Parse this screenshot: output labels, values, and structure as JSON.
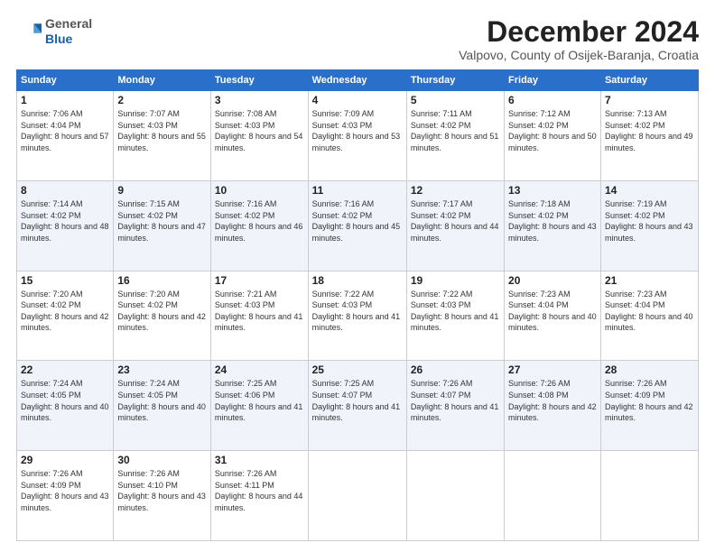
{
  "logo": {
    "general": "General",
    "blue": "Blue"
  },
  "title": "December 2024",
  "location": "Valpovo, County of Osijek-Baranja, Croatia",
  "headers": [
    "Sunday",
    "Monday",
    "Tuesday",
    "Wednesday",
    "Thursday",
    "Friday",
    "Saturday"
  ],
  "weeks": [
    [
      {
        "day": "1",
        "sunrise": "Sunrise: 7:06 AM",
        "sunset": "Sunset: 4:04 PM",
        "daylight": "Daylight: 8 hours and 57 minutes."
      },
      {
        "day": "2",
        "sunrise": "Sunrise: 7:07 AM",
        "sunset": "Sunset: 4:03 PM",
        "daylight": "Daylight: 8 hours and 55 minutes."
      },
      {
        "day": "3",
        "sunrise": "Sunrise: 7:08 AM",
        "sunset": "Sunset: 4:03 PM",
        "daylight": "Daylight: 8 hours and 54 minutes."
      },
      {
        "day": "4",
        "sunrise": "Sunrise: 7:09 AM",
        "sunset": "Sunset: 4:03 PM",
        "daylight": "Daylight: 8 hours and 53 minutes."
      },
      {
        "day": "5",
        "sunrise": "Sunrise: 7:11 AM",
        "sunset": "Sunset: 4:02 PM",
        "daylight": "Daylight: 8 hours and 51 minutes."
      },
      {
        "day": "6",
        "sunrise": "Sunrise: 7:12 AM",
        "sunset": "Sunset: 4:02 PM",
        "daylight": "Daylight: 8 hours and 50 minutes."
      },
      {
        "day": "7",
        "sunrise": "Sunrise: 7:13 AM",
        "sunset": "Sunset: 4:02 PM",
        "daylight": "Daylight: 8 hours and 49 minutes."
      }
    ],
    [
      {
        "day": "8",
        "sunrise": "Sunrise: 7:14 AM",
        "sunset": "Sunset: 4:02 PM",
        "daylight": "Daylight: 8 hours and 48 minutes."
      },
      {
        "day": "9",
        "sunrise": "Sunrise: 7:15 AM",
        "sunset": "Sunset: 4:02 PM",
        "daylight": "Daylight: 8 hours and 47 minutes."
      },
      {
        "day": "10",
        "sunrise": "Sunrise: 7:16 AM",
        "sunset": "Sunset: 4:02 PM",
        "daylight": "Daylight: 8 hours and 46 minutes."
      },
      {
        "day": "11",
        "sunrise": "Sunrise: 7:16 AM",
        "sunset": "Sunset: 4:02 PM",
        "daylight": "Daylight: 8 hours and 45 minutes."
      },
      {
        "day": "12",
        "sunrise": "Sunrise: 7:17 AM",
        "sunset": "Sunset: 4:02 PM",
        "daylight": "Daylight: 8 hours and 44 minutes."
      },
      {
        "day": "13",
        "sunrise": "Sunrise: 7:18 AM",
        "sunset": "Sunset: 4:02 PM",
        "daylight": "Daylight: 8 hours and 43 minutes."
      },
      {
        "day": "14",
        "sunrise": "Sunrise: 7:19 AM",
        "sunset": "Sunset: 4:02 PM",
        "daylight": "Daylight: 8 hours and 43 minutes."
      }
    ],
    [
      {
        "day": "15",
        "sunrise": "Sunrise: 7:20 AM",
        "sunset": "Sunset: 4:02 PM",
        "daylight": "Daylight: 8 hours and 42 minutes."
      },
      {
        "day": "16",
        "sunrise": "Sunrise: 7:20 AM",
        "sunset": "Sunset: 4:02 PM",
        "daylight": "Daylight: 8 hours and 42 minutes."
      },
      {
        "day": "17",
        "sunrise": "Sunrise: 7:21 AM",
        "sunset": "Sunset: 4:03 PM",
        "daylight": "Daylight: 8 hours and 41 minutes."
      },
      {
        "day": "18",
        "sunrise": "Sunrise: 7:22 AM",
        "sunset": "Sunset: 4:03 PM",
        "daylight": "Daylight: 8 hours and 41 minutes."
      },
      {
        "day": "19",
        "sunrise": "Sunrise: 7:22 AM",
        "sunset": "Sunset: 4:03 PM",
        "daylight": "Daylight: 8 hours and 41 minutes."
      },
      {
        "day": "20",
        "sunrise": "Sunrise: 7:23 AM",
        "sunset": "Sunset: 4:04 PM",
        "daylight": "Daylight: 8 hours and 40 minutes."
      },
      {
        "day": "21",
        "sunrise": "Sunrise: 7:23 AM",
        "sunset": "Sunset: 4:04 PM",
        "daylight": "Daylight: 8 hours and 40 minutes."
      }
    ],
    [
      {
        "day": "22",
        "sunrise": "Sunrise: 7:24 AM",
        "sunset": "Sunset: 4:05 PM",
        "daylight": "Daylight: 8 hours and 40 minutes."
      },
      {
        "day": "23",
        "sunrise": "Sunrise: 7:24 AM",
        "sunset": "Sunset: 4:05 PM",
        "daylight": "Daylight: 8 hours and 40 minutes."
      },
      {
        "day": "24",
        "sunrise": "Sunrise: 7:25 AM",
        "sunset": "Sunset: 4:06 PM",
        "daylight": "Daylight: 8 hours and 41 minutes."
      },
      {
        "day": "25",
        "sunrise": "Sunrise: 7:25 AM",
        "sunset": "Sunset: 4:07 PM",
        "daylight": "Daylight: 8 hours and 41 minutes."
      },
      {
        "day": "26",
        "sunrise": "Sunrise: 7:26 AM",
        "sunset": "Sunset: 4:07 PM",
        "daylight": "Daylight: 8 hours and 41 minutes."
      },
      {
        "day": "27",
        "sunrise": "Sunrise: 7:26 AM",
        "sunset": "Sunset: 4:08 PM",
        "daylight": "Daylight: 8 hours and 42 minutes."
      },
      {
        "day": "28",
        "sunrise": "Sunrise: 7:26 AM",
        "sunset": "Sunset: 4:09 PM",
        "daylight": "Daylight: 8 hours and 42 minutes."
      }
    ],
    [
      {
        "day": "29",
        "sunrise": "Sunrise: 7:26 AM",
        "sunset": "Sunset: 4:09 PM",
        "daylight": "Daylight: 8 hours and 43 minutes."
      },
      {
        "day": "30",
        "sunrise": "Sunrise: 7:26 AM",
        "sunset": "Sunset: 4:10 PM",
        "daylight": "Daylight: 8 hours and 43 minutes."
      },
      {
        "day": "31",
        "sunrise": "Sunrise: 7:26 AM",
        "sunset": "Sunset: 4:11 PM",
        "daylight": "Daylight: 8 hours and 44 minutes."
      },
      null,
      null,
      null,
      null
    ]
  ]
}
